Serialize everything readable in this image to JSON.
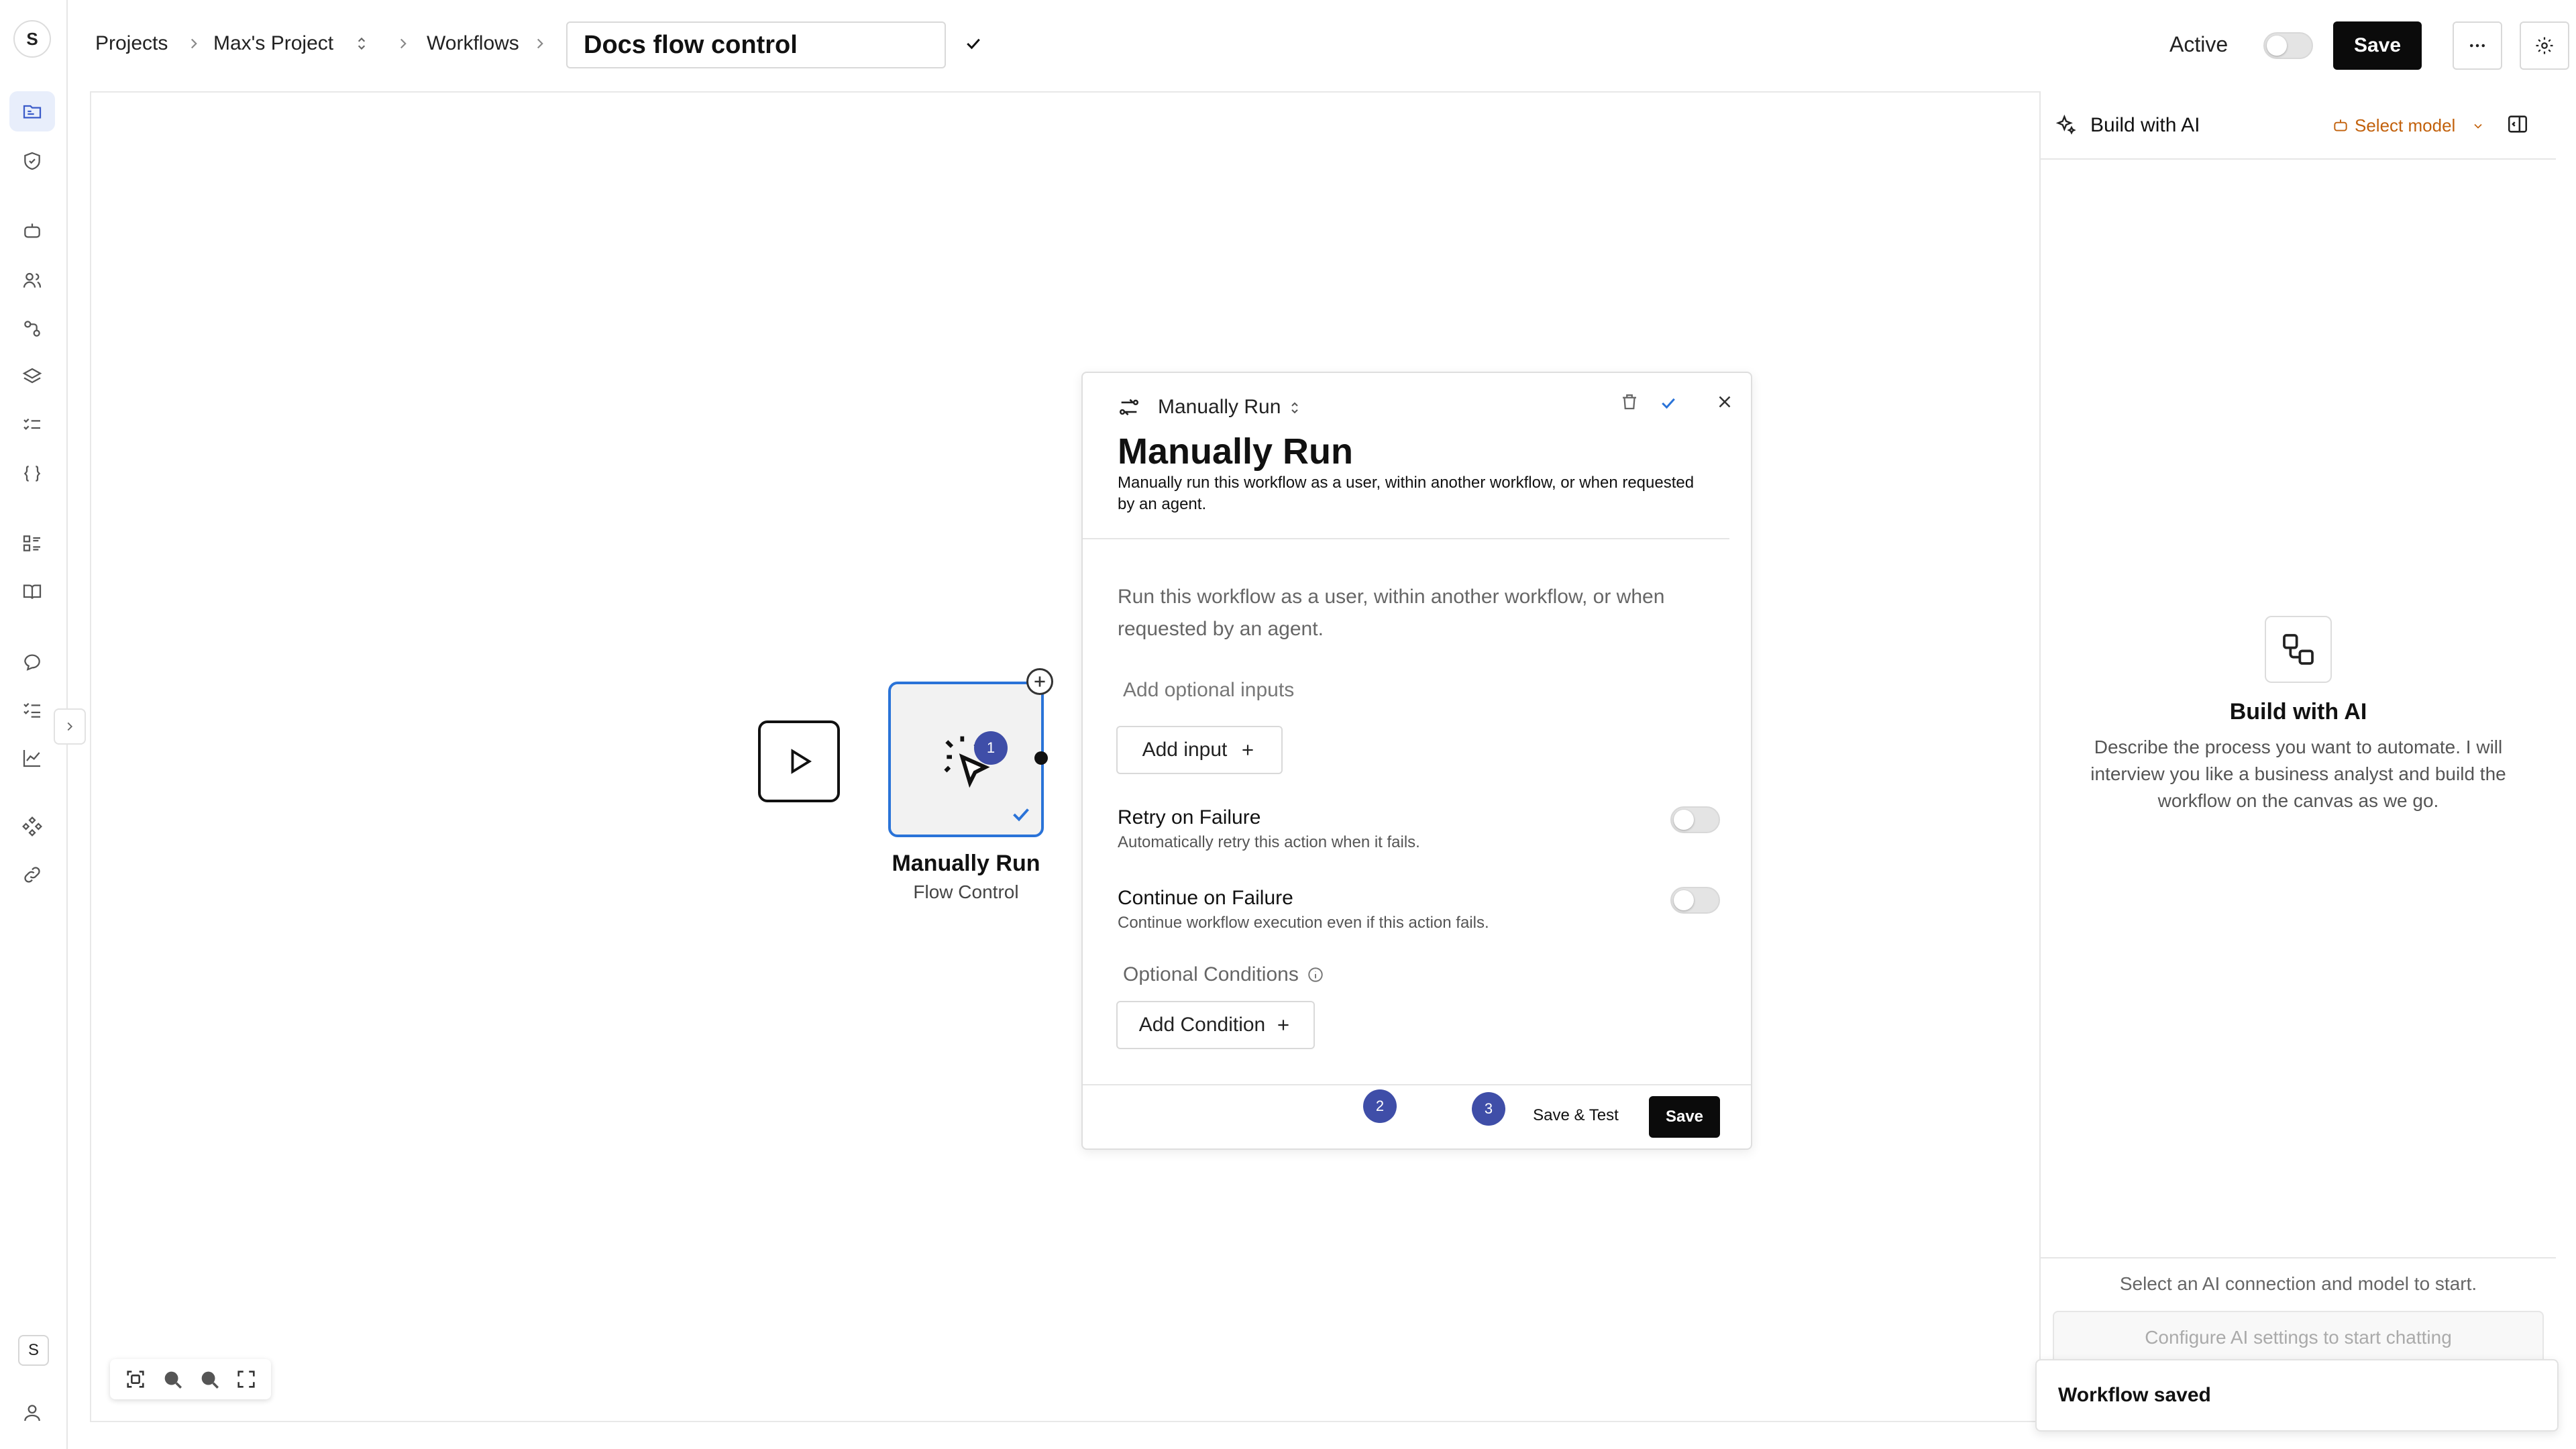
{
  "workspace": {
    "initial": "S",
    "user_initial": "S"
  },
  "breadcrumb": {
    "projects": "Projects",
    "project": "Max's Project",
    "workflows": "Workflows",
    "workflow_name": "Docs flow control"
  },
  "header": {
    "active_label": "Active",
    "save_label": "Save"
  },
  "sidebar": {
    "icons": [
      "projects-icon",
      "shield-icon",
      "robot-icon",
      "users-icon",
      "connections-icon",
      "layers-icon",
      "checklist-icon",
      "code-braces-icon",
      "list-grid-icon",
      "book-icon",
      "chat-icon",
      "tasks-icon",
      "chart-icon",
      "components-icon",
      "link-icon",
      "user-icon"
    ]
  },
  "canvas": {
    "node_title": "Manually Run",
    "node_subtitle": "Flow Control",
    "badges": [
      "1",
      "2",
      "3"
    ]
  },
  "panel": {
    "selector_label": "Manually Run",
    "title": "Manually Run",
    "description": "Manually run this workflow as a user, within another workflow, or when requested by an agent.",
    "info_text": "Run this workflow as a user, within another workflow, or when requested by an agent.",
    "inputs_label": "Add optional inputs",
    "add_input": "Add input",
    "retry_title": "Retry on Failure",
    "retry_desc": "Automatically retry this action when it fails.",
    "continue_title": "Continue on Failure",
    "continue_desc": "Continue workflow execution even if this action fails.",
    "conditions_label": "Optional Conditions",
    "add_condition": "Add Condition",
    "save_test": "Save & Test",
    "save": "Save"
  },
  "ai": {
    "header_title": "Build with AI",
    "select_model": "Select model",
    "empty_title": "Build with AI",
    "empty_desc": "Describe the process you want to automate. I will interview you like a business analyst and build the workflow on the canvas as we go.",
    "hint": "Select an AI connection and model to start.",
    "input_placeholder": "Configure AI settings to start chatting"
  },
  "toast": {
    "message": "Workflow saved"
  },
  "colors": {
    "accent": "#2a73d8",
    "badge": "#3f4ea8",
    "active_nav": "#3b5bc9",
    "model_orange": "#c2610c"
  }
}
